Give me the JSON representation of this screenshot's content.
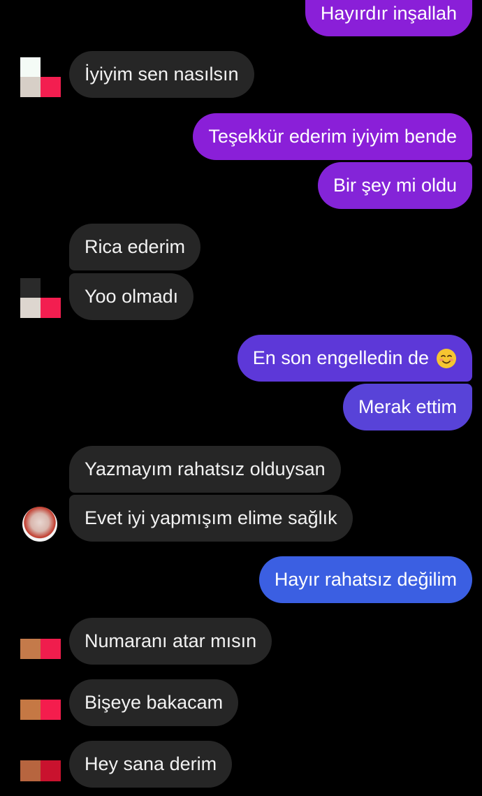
{
  "messages": [
    {
      "text": "Hayırdır inşallah",
      "color": "#8a1fd8"
    },
    {
      "text": "İyiyim sen nasılsın"
    },
    {
      "text": "Teşekkür ederim iyiyim bende",
      "color": "#8a1fd8"
    },
    {
      "text": "Bir şey mi oldu",
      "color": "#8424d8"
    },
    {
      "text": "Rica ederim"
    },
    {
      "text": "Yoo olmadı"
    },
    {
      "text": "En son engelledin de",
      "color": "#5d38d8",
      "emoji": "smiling-face-icon"
    },
    {
      "text": "Merak ettim",
      "color": "#5843d8"
    },
    {
      "text": "Yazmayım rahatsız olduysan"
    },
    {
      "text": "Evet iyi yapmışım elime sağlık"
    },
    {
      "text": "Hayır rahatsız değilim",
      "color": "#3b5fe2"
    },
    {
      "text": "Numaranı atar mısın"
    },
    {
      "text": "Bişeye bakacam"
    },
    {
      "text": "Hey sana derim"
    }
  ],
  "colors": {
    "background": "#000000",
    "incoming_bubble": "#262626",
    "outgoing_purple": "#8a1fd8",
    "outgoing_violet": "#5d38d8",
    "outgoing_blue": "#3b5fe2"
  }
}
